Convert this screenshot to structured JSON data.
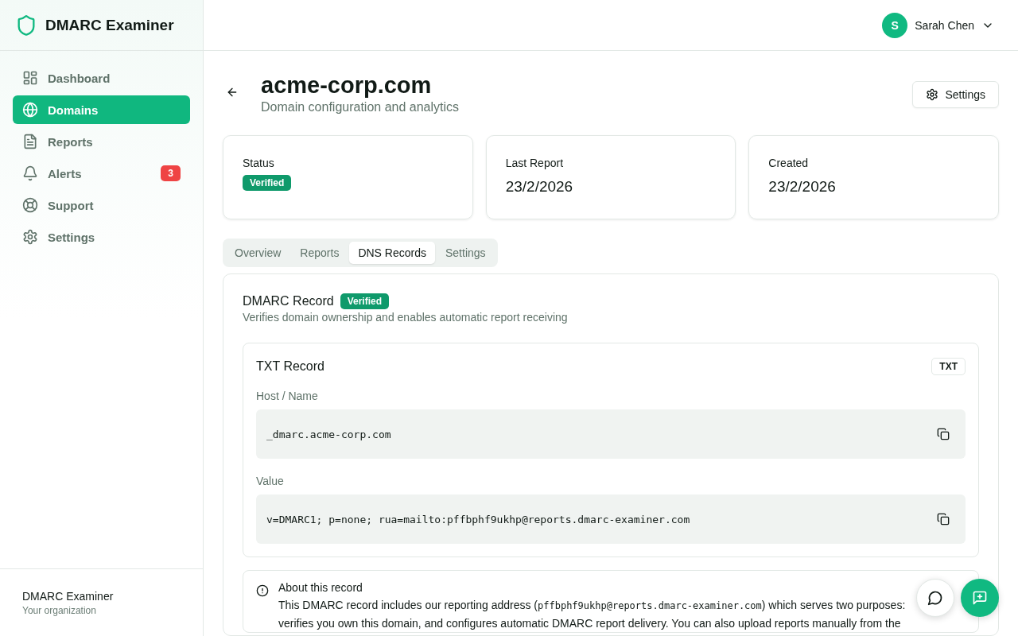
{
  "sidebar": {
    "brand": "DMARC Examiner",
    "items": [
      {
        "label": "Dashboard",
        "selected": false
      },
      {
        "label": "Domains",
        "selected": true
      },
      {
        "label": "Reports",
        "selected": false
      },
      {
        "label": "Alerts",
        "selected": false,
        "badge": "3"
      },
      {
        "label": "Support",
        "selected": false
      },
      {
        "label": "Settings",
        "selected": false
      }
    ],
    "footer": {
      "name": "DMARC Examiner",
      "subtitle": "Your organization"
    }
  },
  "header": {
    "user": {
      "initial": "S",
      "name": "Sarah Chen"
    }
  },
  "page": {
    "title": "acme-corp.com",
    "subtitle": "Domain configuration and analytics",
    "settings_button": "Settings"
  },
  "stats": [
    {
      "label": "Status",
      "badge": "Verified"
    },
    {
      "label": "Last Report",
      "value": "23/2/2026"
    },
    {
      "label": "Created",
      "value": "23/2/2026"
    }
  ],
  "tabs": [
    {
      "label": "Overview",
      "selected": false
    },
    {
      "label": "Reports",
      "selected": false
    },
    {
      "label": "DNS Records",
      "selected": true
    },
    {
      "label": "Settings",
      "selected": false
    }
  ],
  "record": {
    "title": "DMARC Record",
    "badge": "Verified",
    "description": "Verifies domain ownership and enables automatic report receiving",
    "txt": {
      "title": "TXT Record",
      "type": "TXT",
      "fields": [
        {
          "label": "Host / Name",
          "value": "_dmarc.acme-corp.com"
        },
        {
          "label": "Value",
          "value": "v=DMARC1; p=none; rua=mailto:pffbphf9ukhp@reports.dmarc-examiner.com"
        }
      ]
    },
    "about": {
      "title": "About this record",
      "text_before": "This DMARC record includes our reporting address (",
      "code": "pffbphf9ukhp@reports.dmarc-examiner.com",
      "text_after": ") which serves two purposes: verifies you own this domain, and configures automatic DMARC report delivery. You can also upload reports manually from the"
    }
  }
}
